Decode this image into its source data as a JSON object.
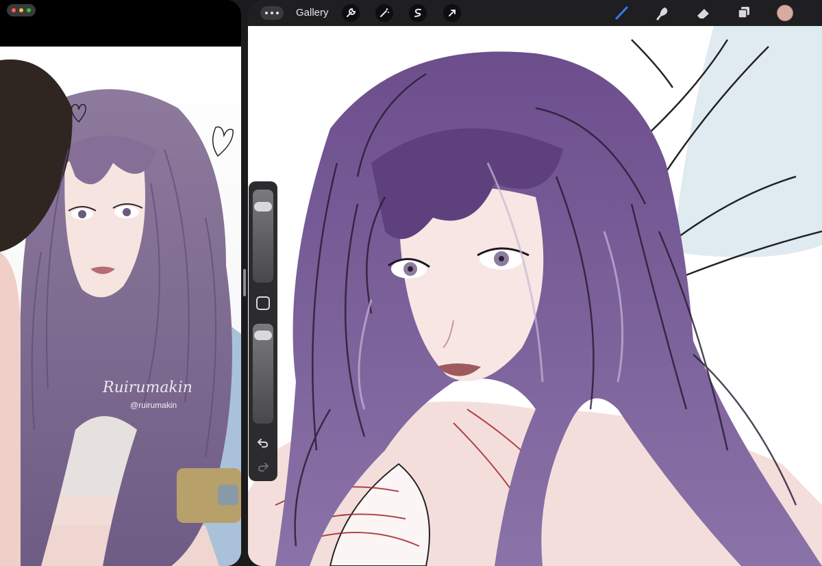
{
  "left_pane": {
    "multitask_dot_colors": [
      "#ff5f57",
      "#febc2e",
      "#28c840"
    ],
    "artwork": {
      "description_icon": "reference-artwork-image",
      "signature_watermark": "Ruirumakin",
      "handle_watermark": "@ruirumakin"
    }
  },
  "toolbar": {
    "more_icon": "ellipsis-icon",
    "gallery_label": "Gallery",
    "left_tools": [
      "wrench-icon",
      "magic-wand-icon",
      "selection-s-icon",
      "arrow-transform-icon"
    ],
    "right_tools": [
      "brush-icon",
      "smudge-icon",
      "eraser-icon",
      "layers-icon"
    ],
    "active_tool": "brush-icon",
    "active_color": "#d8aaa0",
    "accent_color": "#2f7df6"
  },
  "sidebar": {
    "brush_size_level": 0.12,
    "brush_opacity_level": 0.05,
    "buttons": [
      "modify-button",
      "undo-icon",
      "redo-icon"
    ]
  },
  "canvas": {
    "artwork_icon": "wip-sketch-artwork-image"
  }
}
